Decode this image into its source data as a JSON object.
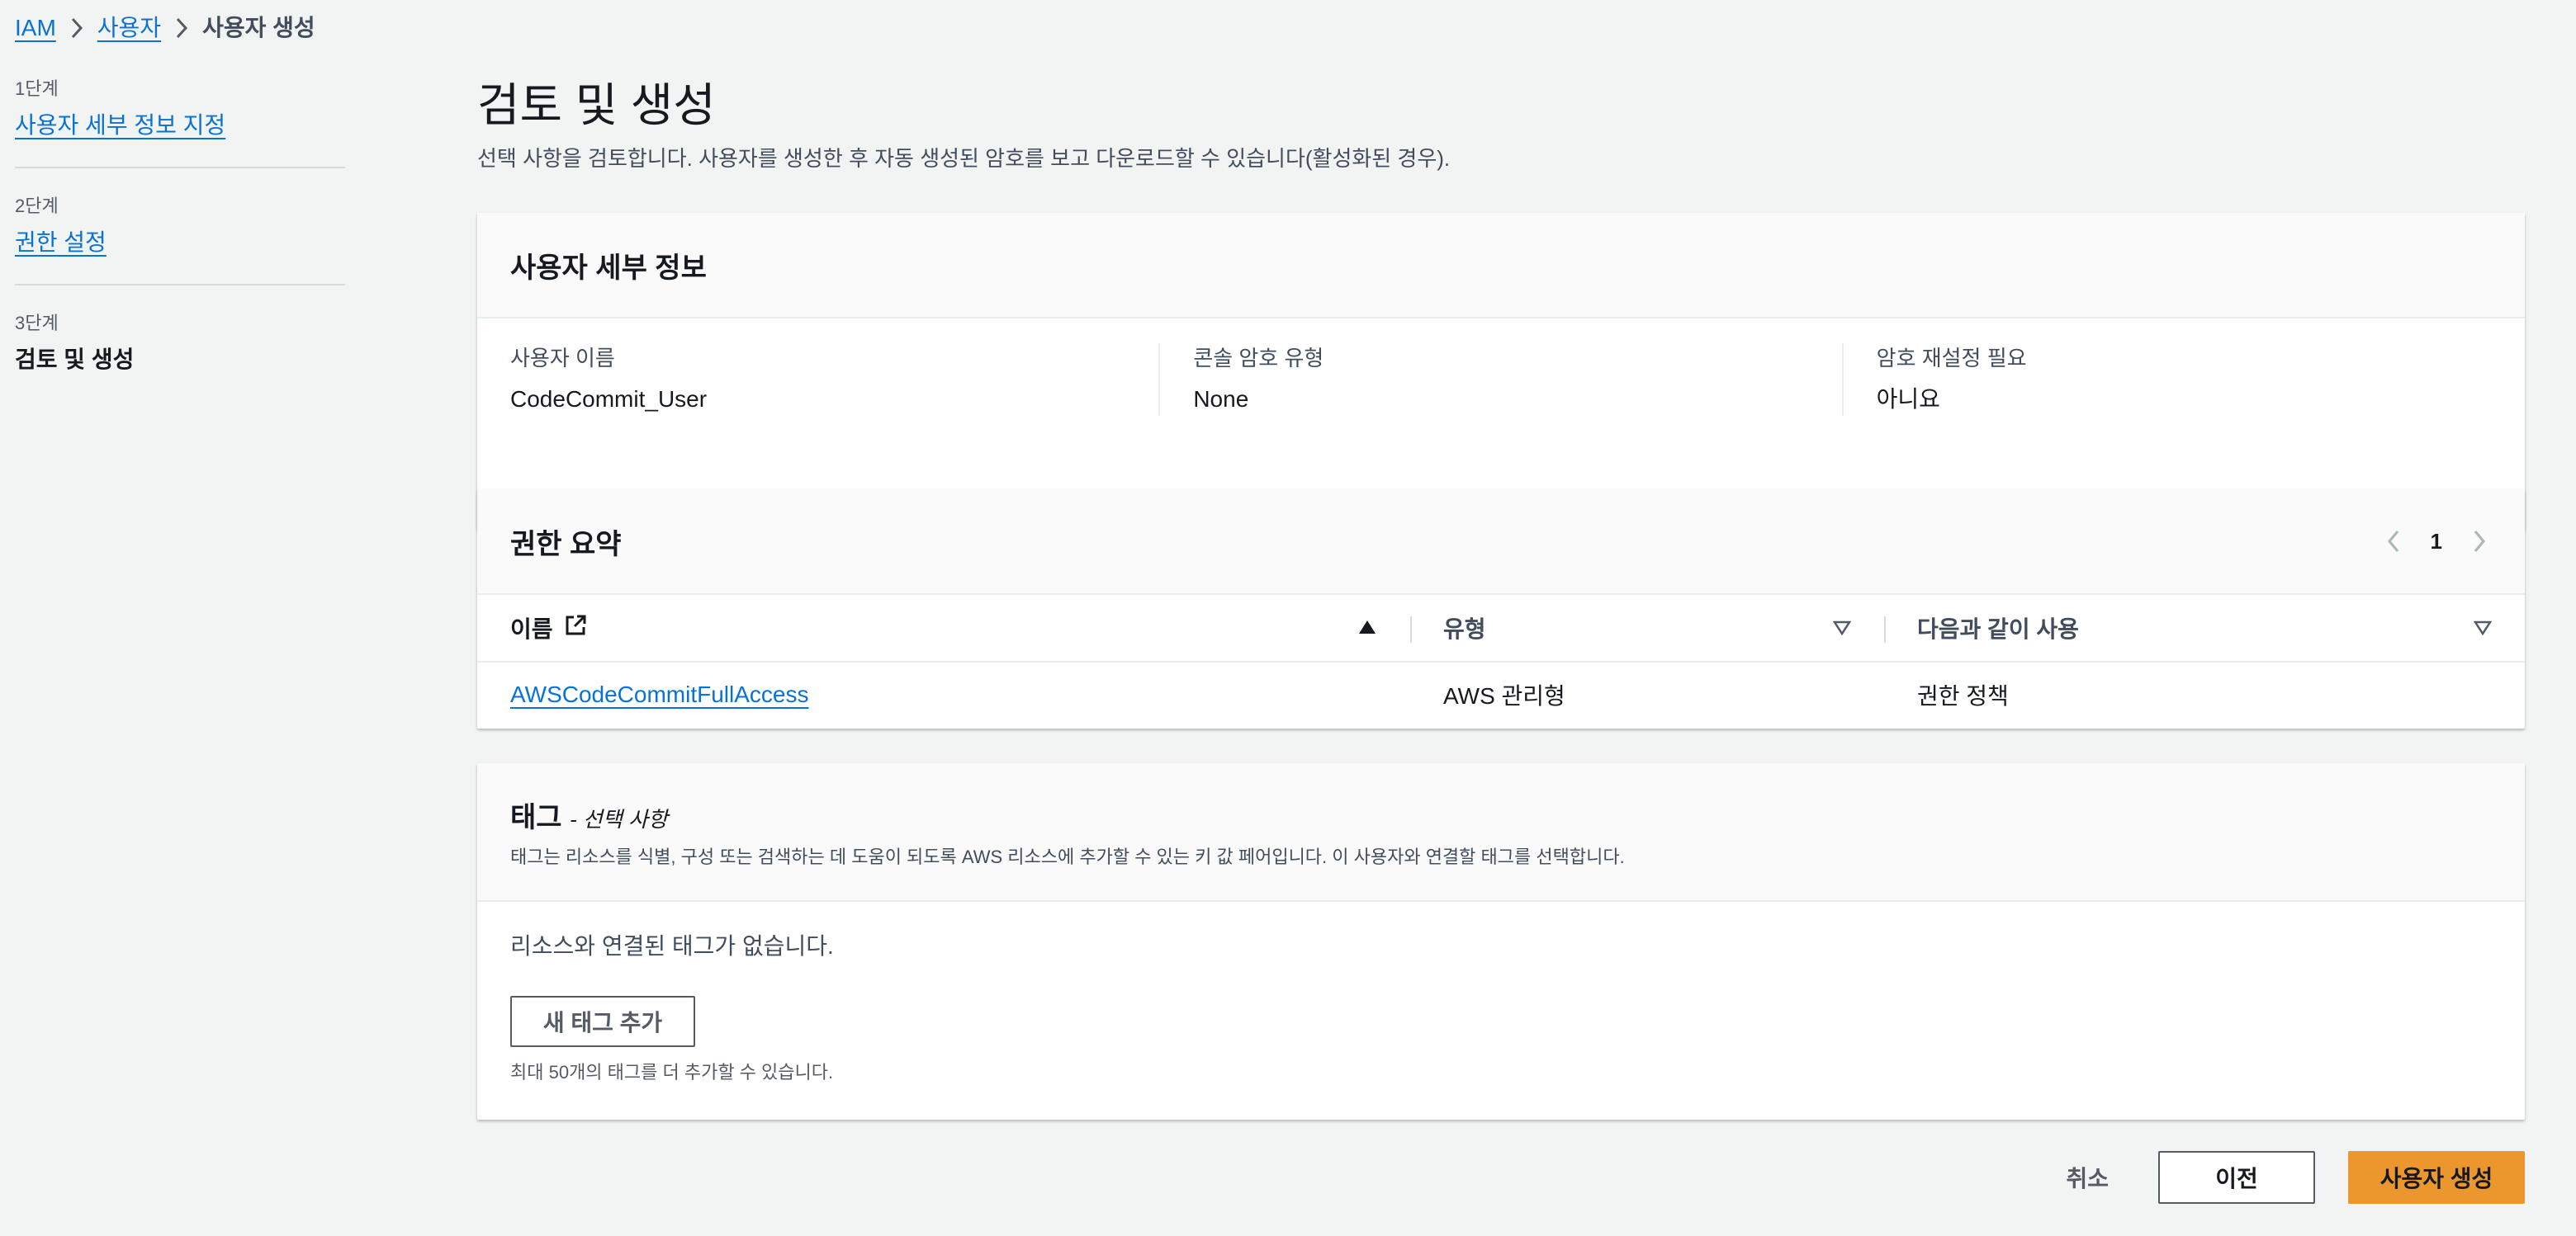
{
  "breadcrumb": {
    "items": [
      {
        "label": "IAM"
      },
      {
        "label": "사용자"
      },
      {
        "label": "사용자 생성"
      }
    ]
  },
  "steps": [
    {
      "num": "1단계",
      "title": "사용자 세부 정보 지정",
      "state": "link"
    },
    {
      "num": "2단계",
      "title": "권한 설정",
      "state": "link"
    },
    {
      "num": "3단계",
      "title": "검토 및 생성",
      "state": "active"
    }
  ],
  "page": {
    "title": "검토 및 생성",
    "description": "선택 사항을 검토합니다. 사용자를 생성한 후 자동 생성된 암호를 보고 다운로드할 수 있습니다(활성화된 경우)."
  },
  "user_details": {
    "header": "사용자 세부 정보",
    "fields": [
      {
        "key": "사용자 이름",
        "value": "CodeCommit_User"
      },
      {
        "key": "콘솔 암호 유형",
        "value": "None"
      },
      {
        "key": "암호 재설정 필요",
        "value": "아니요"
      }
    ]
  },
  "permissions": {
    "header": "권한 요약",
    "page": "1",
    "columns": [
      {
        "label": "이름",
        "sort": "asc",
        "icon": "external-link-icon"
      },
      {
        "label": "유형",
        "sort": "none"
      },
      {
        "label": "다음과 같이 사용",
        "sort": "none"
      }
    ],
    "rows": [
      {
        "name": "AWSCodeCommitFullAccess",
        "type": "AWS 관리형",
        "used_as": "권한 정책"
      }
    ]
  },
  "tags": {
    "header": "태그",
    "optional": "- 선택 사항",
    "description": "태그는 리소스를 식별, 구성 또는 검색하는 데 도움이 되도록 AWS 리소스에 추가할 수 있는 키 값 페어입니다. 이 사용자와 연결할 태그를 선택합니다.",
    "empty": "리소스와 연결된 태그가 없습니다.",
    "add_button": "새 태그 추가",
    "limit_text": "최대 50개의 태그를 더 추가할 수 있습니다."
  },
  "actions": {
    "cancel": "취소",
    "previous": "이전",
    "create": "사용자 생성"
  },
  "colors": {
    "link": "#0972d3",
    "primary_button": "#ec972d",
    "background": "#f2f3f3"
  }
}
